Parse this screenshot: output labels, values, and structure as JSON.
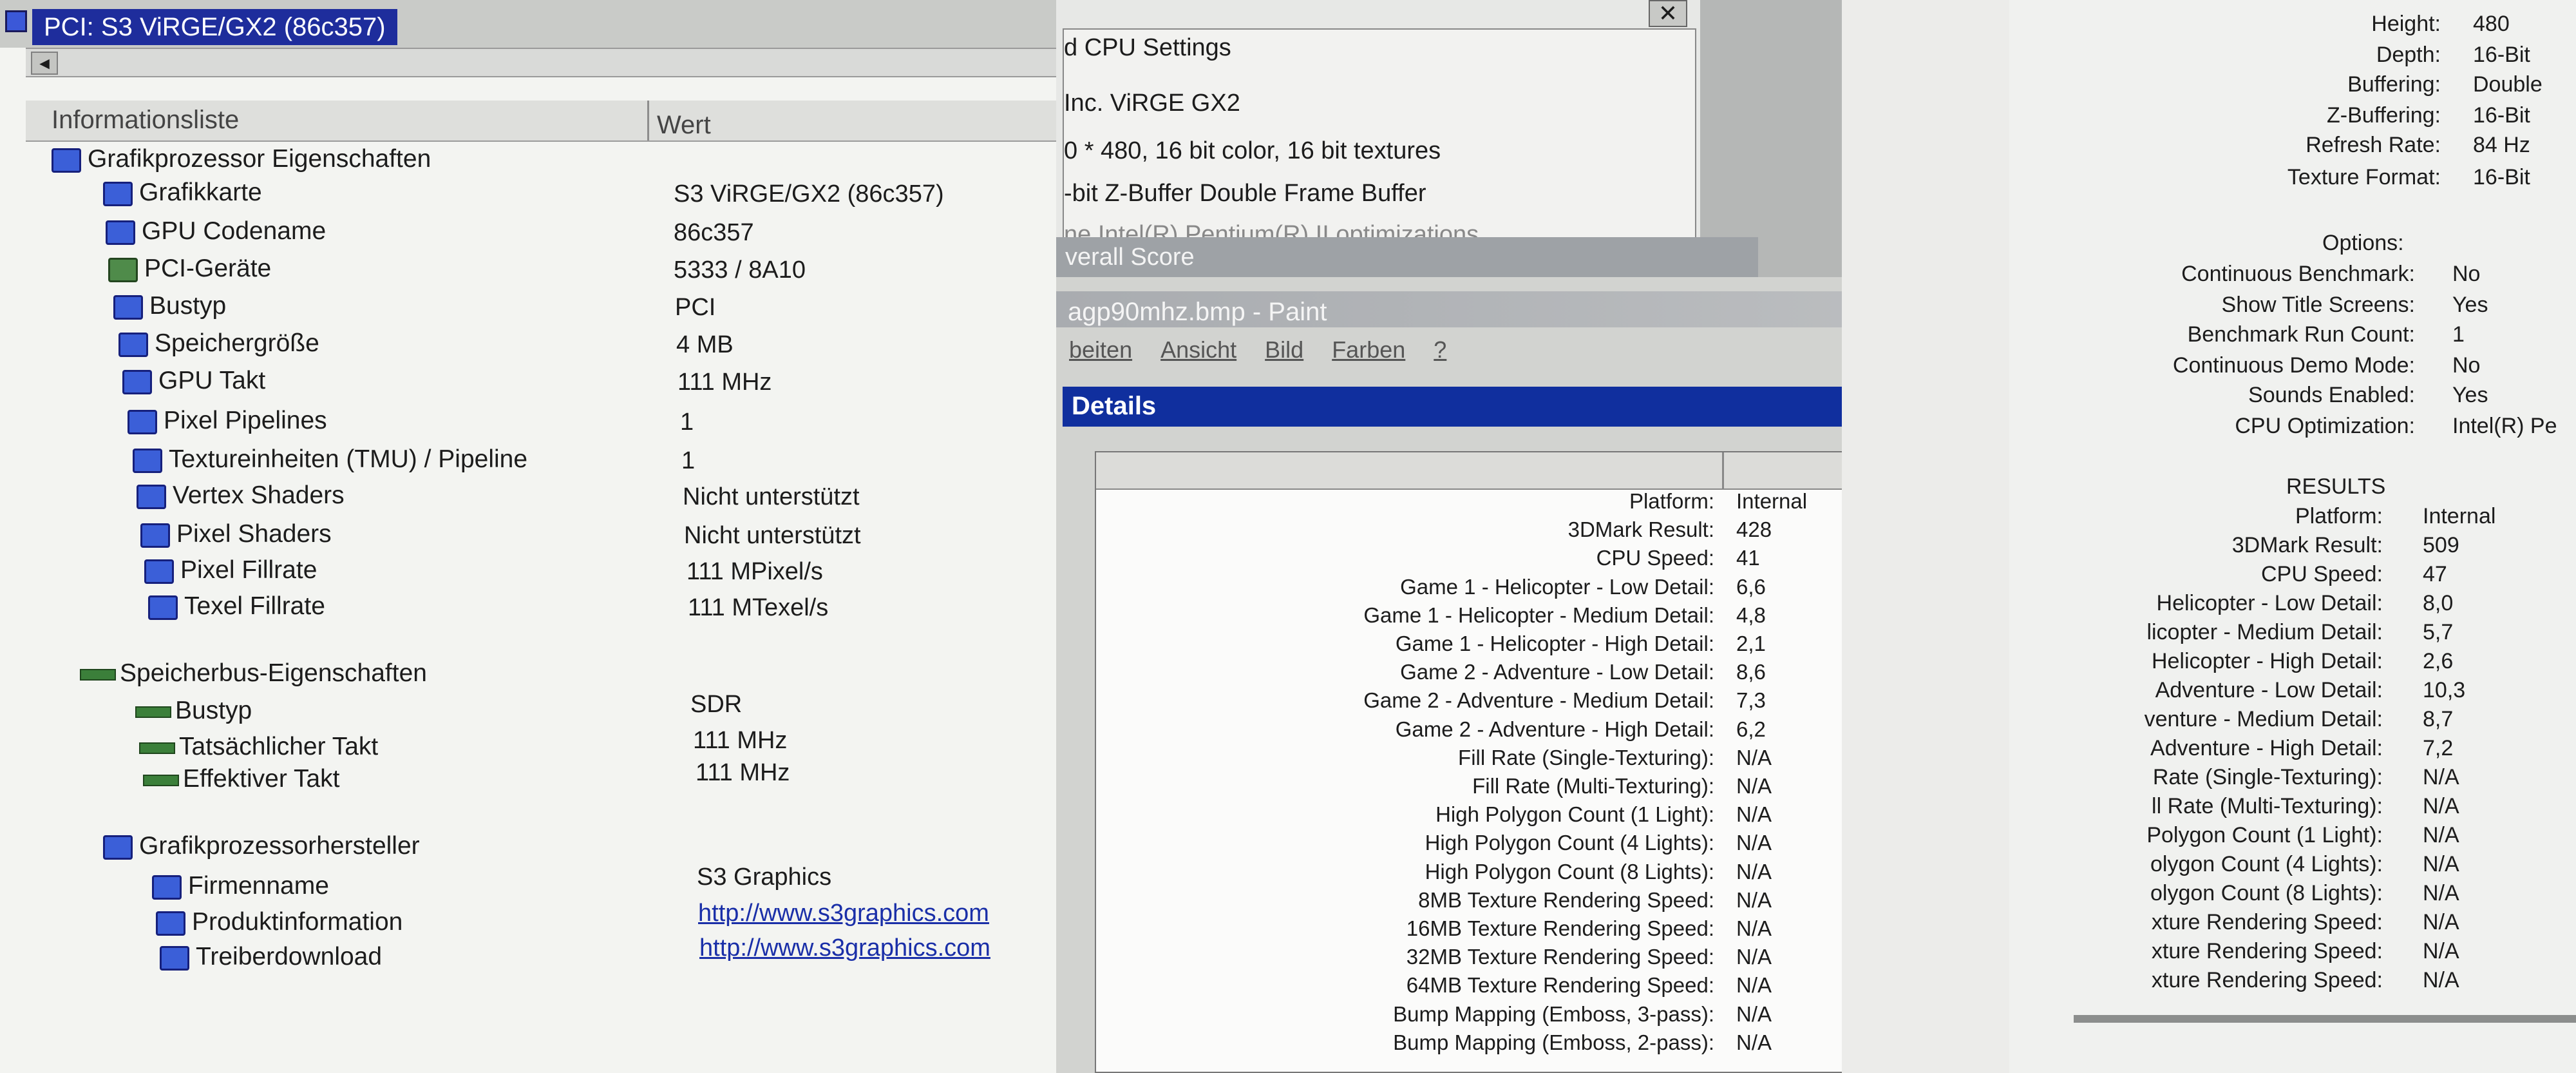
{
  "device_selector": "PCI: S3 ViRGE/GX2 (86c357)",
  "left_panel": {
    "col_header_1": "Informationsliste",
    "col_header_2": "Wert",
    "gpu_section": "Grafikprozessor Eigenschaften",
    "gpu_props": [
      {
        "label": "Grafikkarte",
        "value": "S3 ViRGE/GX2 (86c357)",
        "icon": "monitor-icon"
      },
      {
        "label": "GPU Codename",
        "value": "86c357",
        "icon": "monitor-icon"
      },
      {
        "label": "PCI-Geräte",
        "value": "5333 / 8A10",
        "icon": "pci-icon"
      },
      {
        "label": "Bustyp",
        "value": "PCI",
        "icon": "monitor-icon"
      },
      {
        "label": "Speichergröße",
        "value": "4 MB",
        "icon": "monitor-icon"
      },
      {
        "label": "GPU Takt",
        "value": "111 MHz",
        "icon": "monitor-icon"
      },
      {
        "label": "Pixel Pipelines",
        "value": "1",
        "icon": "monitor-icon"
      },
      {
        "label": "Textureinheiten (TMU) / Pipeline",
        "value": "1",
        "icon": "monitor-icon"
      },
      {
        "label": "Vertex Shaders",
        "value": "Nicht unterstützt",
        "icon": "monitor-icon"
      },
      {
        "label": "Pixel Shaders",
        "value": "Nicht unterstützt",
        "icon": "monitor-icon"
      },
      {
        "label": "Pixel Fillrate",
        "value": "111 MPixel/s",
        "icon": "monitor-icon"
      },
      {
        "label": "Texel Fillrate",
        "value": "111 MTexel/s",
        "icon": "monitor-icon"
      }
    ],
    "mem_section": "Speicherbus-Eigenschaften",
    "mem_props": [
      {
        "label": "Bustyp",
        "value": "SDR"
      },
      {
        "label": "Tatsächlicher Takt",
        "value": "111 MHz"
      },
      {
        "label": "Effektiver Takt",
        "value": "111 MHz"
      }
    ],
    "vendor_section": "Grafikprozessorhersteller",
    "vendor_props": [
      {
        "label": "Firmenname",
        "value": "S3 Graphics"
      },
      {
        "label": "Produktinformation",
        "value": "http://www.s3graphics.com"
      },
      {
        "label": "Treiberdownload",
        "value": "http://www.s3graphics.com"
      }
    ]
  },
  "middle_top": {
    "close_glyph": "✕",
    "line1": "d CPU Settings",
    "line2": "Inc. ViRGE GX2",
    "line3": "0 * 480, 16 bit color, 16 bit textures",
    "line4": "-bit Z-Buffer  Double Frame Buffer",
    "line5": "ne  Intel(R) Pentium(R) II optimizations",
    "overall": "verall Score"
  },
  "paint_window": {
    "title": "agp90mhz.bmp - Paint",
    "btn_min": "_",
    "btn_max": "□",
    "btn_close": "✕",
    "menu": [
      "beiten",
      "Ansicht",
      "Bild",
      "Farben",
      "?"
    ]
  },
  "details": {
    "title": "Details",
    "rows": [
      {
        "label": "Platform:",
        "value": "Internal"
      },
      {
        "label": "3DMark Result:",
        "value": "428"
      },
      {
        "label": "CPU Speed:",
        "value": "41"
      },
      {
        "label": "Game 1 - Helicopter - Low Detail:",
        "value": "6,6"
      },
      {
        "label": "Game 1 - Helicopter - Medium Detail:",
        "value": "4,8"
      },
      {
        "label": "Game 1 - Helicopter - High Detail:",
        "value": "2,1"
      },
      {
        "label": "Game 2 - Adventure - Low Detail:",
        "value": "8,6"
      },
      {
        "label": "Game 2 - Adventure - Medium Detail:",
        "value": "7,3"
      },
      {
        "label": "Game 2 - Adventure - High Detail:",
        "value": "6,2"
      },
      {
        "label": "Fill Rate (Single-Texturing):",
        "value": "N/A"
      },
      {
        "label": "Fill Rate (Multi-Texturing):",
        "value": "N/A"
      },
      {
        "label": "High Polygon Count (1 Light):",
        "value": "N/A"
      },
      {
        "label": "High Polygon Count (4 Lights):",
        "value": "N/A"
      },
      {
        "label": "High Polygon Count (8 Lights):",
        "value": "N/A"
      },
      {
        "label": "8MB Texture Rendering Speed:",
        "value": "N/A"
      },
      {
        "label": "16MB Texture Rendering Speed:",
        "value": "N/A"
      },
      {
        "label": "32MB Texture Rendering Speed:",
        "value": "N/A"
      },
      {
        "label": "64MB Texture Rendering Speed:",
        "value": "N/A"
      },
      {
        "label": "Bump Mapping (Emboss, 3-pass):",
        "value": "N/A"
      },
      {
        "label": "Bump Mapping (Emboss, 2-pass):",
        "value": "N/A"
      }
    ]
  },
  "right_panel": {
    "settings": [
      {
        "label": "Height:",
        "value": "480"
      },
      {
        "label": "Depth:",
        "value": "16-Bit"
      },
      {
        "label": "Buffering:",
        "value": "Double"
      },
      {
        "label": "Z-Buffering:",
        "value": "16-Bit"
      },
      {
        "label": "Refresh Rate:",
        "value": "84 Hz"
      },
      {
        "label": "Texture Format:",
        "value": "16-Bit"
      }
    ],
    "options_header": "Options:",
    "options": [
      {
        "label": "Continuous Benchmark:",
        "value": "No"
      },
      {
        "label": "Show Title Screens:",
        "value": "Yes"
      },
      {
        "label": "Benchmark Run Count:",
        "value": "1"
      },
      {
        "label": "Continuous Demo Mode:",
        "value": "No"
      },
      {
        "label": "Sounds Enabled:",
        "value": "Yes"
      },
      {
        "label": "CPU Optimization:",
        "value": "Intel(R) Pe"
      }
    ],
    "results_header": "RESULTS",
    "results": [
      {
        "label": "Platform:",
        "value": "Internal"
      },
      {
        "label": "3DMark Result:",
        "value": "509"
      },
      {
        "label": "CPU Speed:",
        "value": "47"
      },
      {
        "label": "Helicopter - Low Detail:",
        "value": "8,0"
      },
      {
        "label": "licopter - Medium Detail:",
        "value": "5,7"
      },
      {
        "label": "Helicopter - High Detail:",
        "value": "2,6"
      },
      {
        "label": "Adventure - Low Detail:",
        "value": "10,3"
      },
      {
        "label": "venture - Medium Detail:",
        "value": "8,7"
      },
      {
        "label": "Adventure - High Detail:",
        "value": "7,2"
      },
      {
        "label": "Rate (Single-Texturing):",
        "value": "N/A"
      },
      {
        "label": "ll Rate (Multi-Texturing):",
        "value": "N/A"
      },
      {
        "label": "Polygon Count (1 Light):",
        "value": "N/A"
      },
      {
        "label": "olygon Count (4 Lights):",
        "value": "N/A"
      },
      {
        "label": "olygon Count (8 Lights):",
        "value": "N/A"
      },
      {
        "label": "xture Rendering Speed:",
        "value": "N/A"
      },
      {
        "label": "xture Rendering Speed:",
        "value": "N/A"
      },
      {
        "label": "xture Rendering Speed:",
        "value": "N/A"
      }
    ]
  }
}
